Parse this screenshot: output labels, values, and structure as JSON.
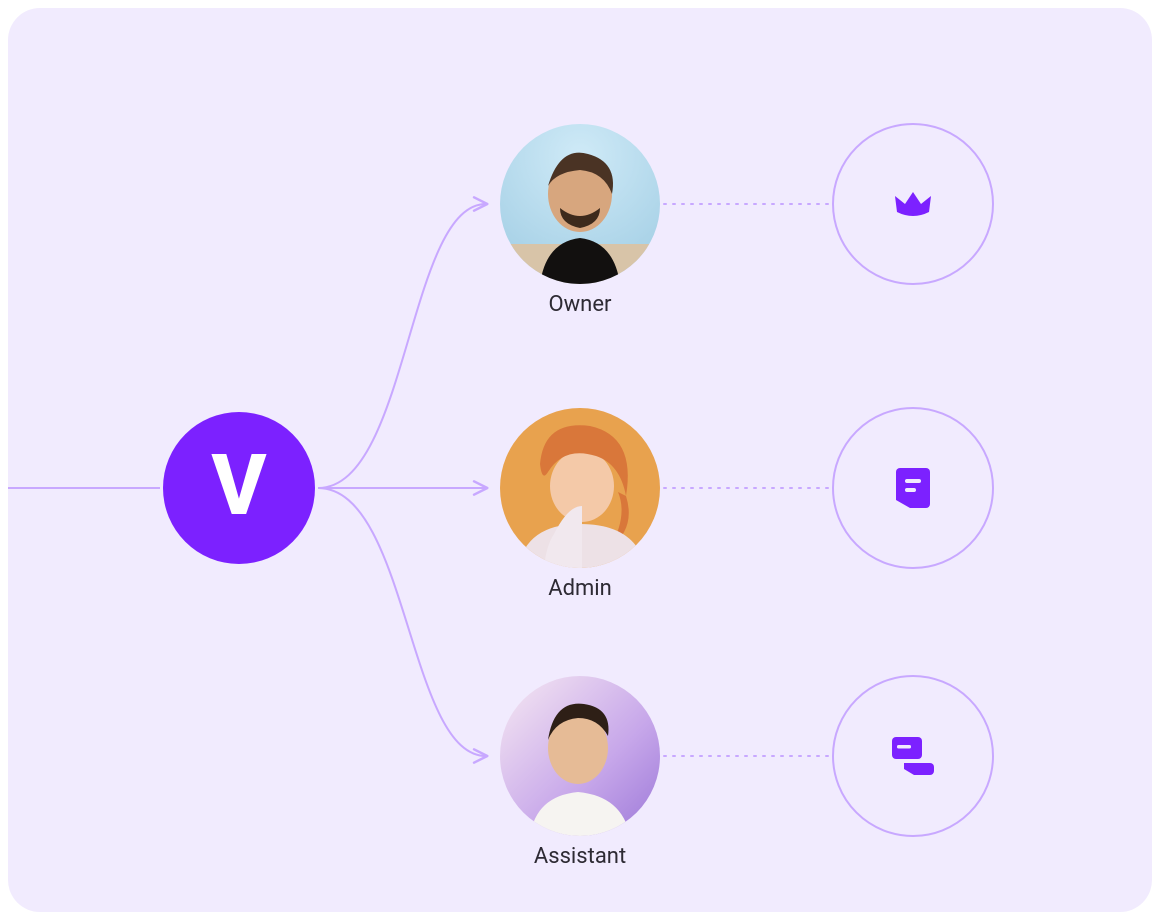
{
  "brand": {
    "letter": "V"
  },
  "roles": [
    {
      "label": "Owner",
      "permission_icon": "crown"
    },
    {
      "label": "Admin",
      "permission_icon": "document"
    },
    {
      "label": "Assistant",
      "permission_icon": "cards"
    }
  ],
  "colors": {
    "background": "#F1EBFE",
    "accent": "#7C21FF",
    "stroke": "#C8A8FF",
    "text": "#2D2A33"
  }
}
